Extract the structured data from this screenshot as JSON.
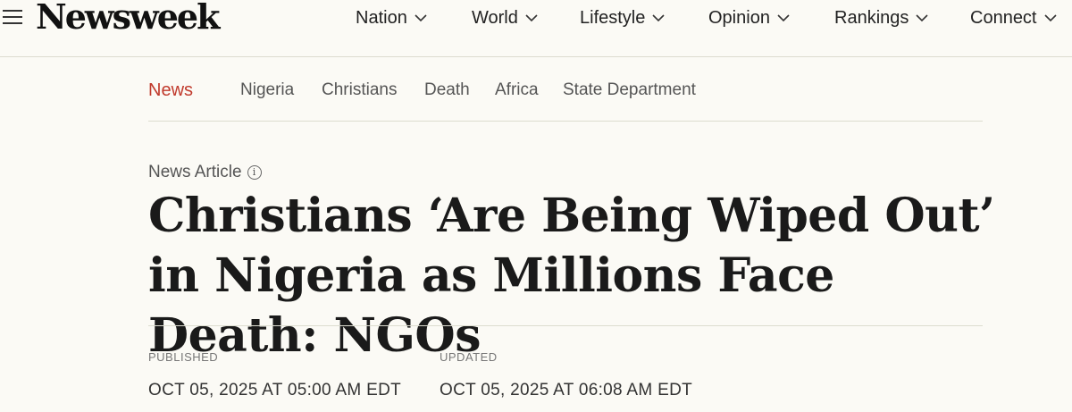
{
  "brand": {
    "logo": "Newsweek"
  },
  "nav": {
    "items": [
      {
        "label": "Nation"
      },
      {
        "label": "World"
      },
      {
        "label": "Lifestyle"
      },
      {
        "label": "Opinion"
      },
      {
        "label": "Rankings"
      },
      {
        "label": "Connect"
      }
    ]
  },
  "section": {
    "active": "News",
    "tags": [
      "Nigeria",
      "Christians",
      "Death",
      "Africa",
      "State Department"
    ]
  },
  "article": {
    "kicker": "News Article",
    "headline": "Christians ‘Are Being Wiped Out’ in Nigeria as Millions Face Death: NGOs",
    "published_label": "PUBLISHED",
    "published_value": "OCT 05, 2025 AT 05:00 AM EDT",
    "updated_label": "UPDATED",
    "updated_value": "OCT 05, 2025 AT 06:08 AM EDT"
  },
  "colors": {
    "accent": "#c0392b",
    "background": "#fbfaf5",
    "text": "#1a1a1a"
  },
  "icons": {
    "menu": "hamburger-icon",
    "dropdown": "chevron-down-icon",
    "info": "info-icon"
  }
}
